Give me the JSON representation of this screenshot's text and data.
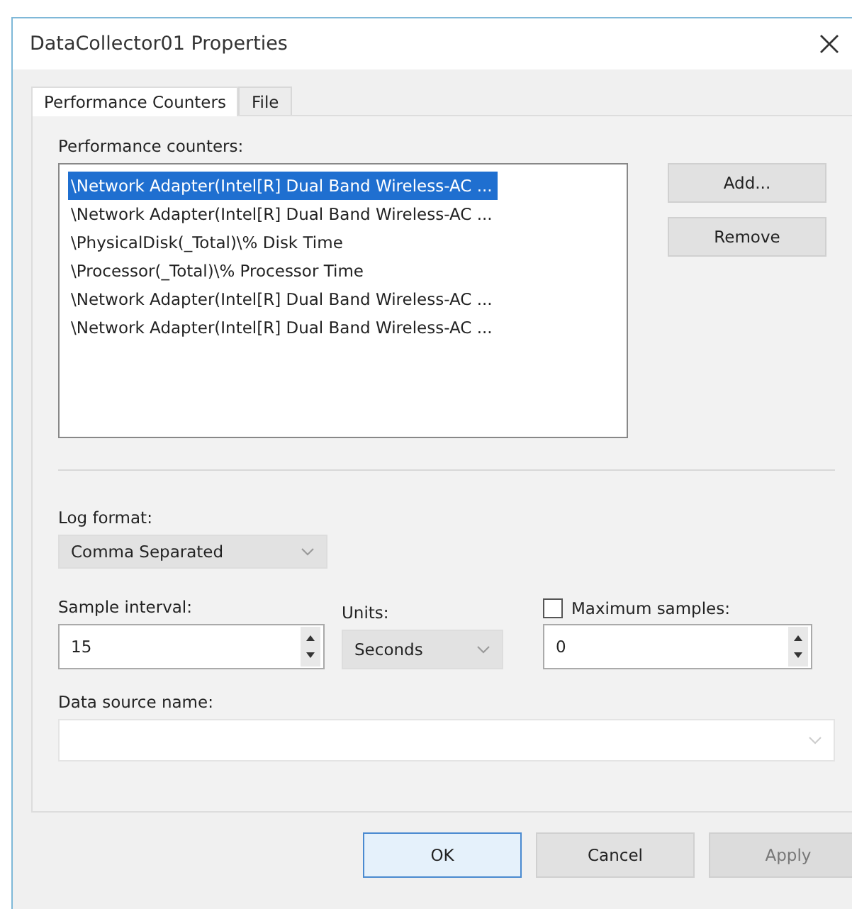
{
  "window": {
    "title": "DataCollector01 Properties"
  },
  "tabs": [
    {
      "label": "Performance Counters",
      "selected": true
    },
    {
      "label": "File",
      "selected": false
    }
  ],
  "counters": {
    "label": "Performance counters:",
    "items": [
      {
        "text": "\\Network Adapter(Intel[R] Dual Band Wireless-AC ...",
        "selected": true
      },
      {
        "text": "\\Network Adapter(Intel[R] Dual Band Wireless-AC ...",
        "selected": false
      },
      {
        "text": "\\PhysicalDisk(_Total)\\% Disk Time",
        "selected": false
      },
      {
        "text": "\\Processor(_Total)\\% Processor Time",
        "selected": false
      },
      {
        "text": "\\Network Adapter(Intel[R] Dual Band Wireless-AC ...",
        "selected": false
      },
      {
        "text": "\\Network Adapter(Intel[R] Dual Band Wireless-AC ...",
        "selected": false
      }
    ]
  },
  "side_buttons": [
    {
      "label": "Add..."
    },
    {
      "label": "Remove"
    }
  ],
  "log_format": {
    "label": "Log format:",
    "value": "Comma Separated"
  },
  "sample_interval": {
    "label": "Sample interval:",
    "value": "15"
  },
  "units": {
    "label": "Units:",
    "value": "Seconds"
  },
  "maximum_samples": {
    "label": "Maximum samples:",
    "checked": false,
    "value": "0"
  },
  "data_source_name": {
    "label": "Data source name:",
    "disabled": true
  },
  "buttons": [
    {
      "label": "OK",
      "default": true,
      "disabled": false
    },
    {
      "label": "Cancel",
      "default": false,
      "disabled": false
    },
    {
      "label": "Apply",
      "default": false,
      "disabled": true
    }
  ]
}
